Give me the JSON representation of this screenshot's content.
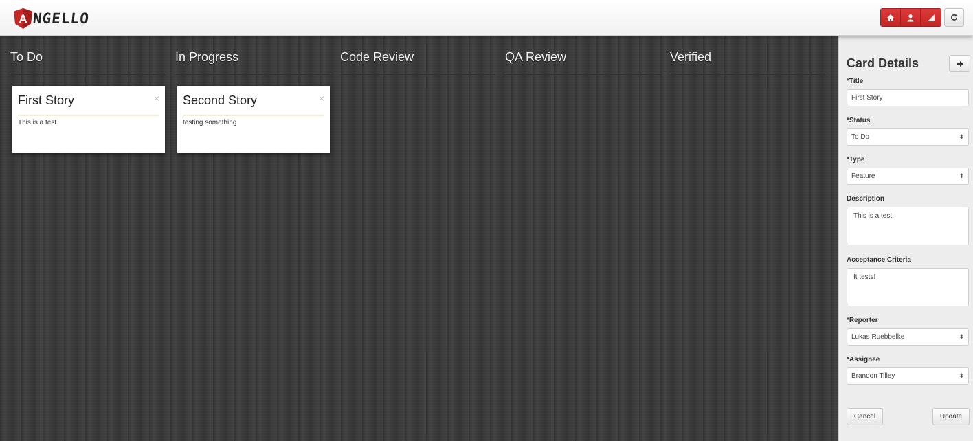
{
  "header": {
    "logo_text": "NGELLO",
    "logo_letter": "A",
    "nav_icons": [
      "home-icon",
      "user-icon",
      "signal-icon"
    ],
    "logout_icon": "refresh-icon",
    "accent_color": "#d32f2f"
  },
  "board": {
    "columns": [
      {
        "title": "To Do"
      },
      {
        "title": "In Progress"
      },
      {
        "title": "Code Review"
      },
      {
        "title": "QA Review"
      },
      {
        "title": "Verified"
      }
    ],
    "cards": [
      {
        "title": "First Story",
        "description": "This is a test",
        "close": "×"
      },
      {
        "title": "Second Story",
        "description": "testing something",
        "close": "×"
      }
    ]
  },
  "details": {
    "title": "Card Details",
    "close_icon": "arrow-right-icon",
    "fields": {
      "title": {
        "label": "*Title",
        "value": "First Story"
      },
      "status": {
        "label": "*Status",
        "value": "To Do"
      },
      "type": {
        "label": "*Type",
        "value": "Feature"
      },
      "description": {
        "label": "Description",
        "value": "This is a test"
      },
      "acceptance": {
        "label": "Acceptance Criteria",
        "value": "It tests!"
      },
      "reporter": {
        "label": "*Reporter",
        "value": "Lukas Ruebbelke"
      },
      "assignee": {
        "label": "*Assignee",
        "value": "Brandon Tilley"
      }
    },
    "cancel_label": "Cancel",
    "update_label": "Update"
  }
}
